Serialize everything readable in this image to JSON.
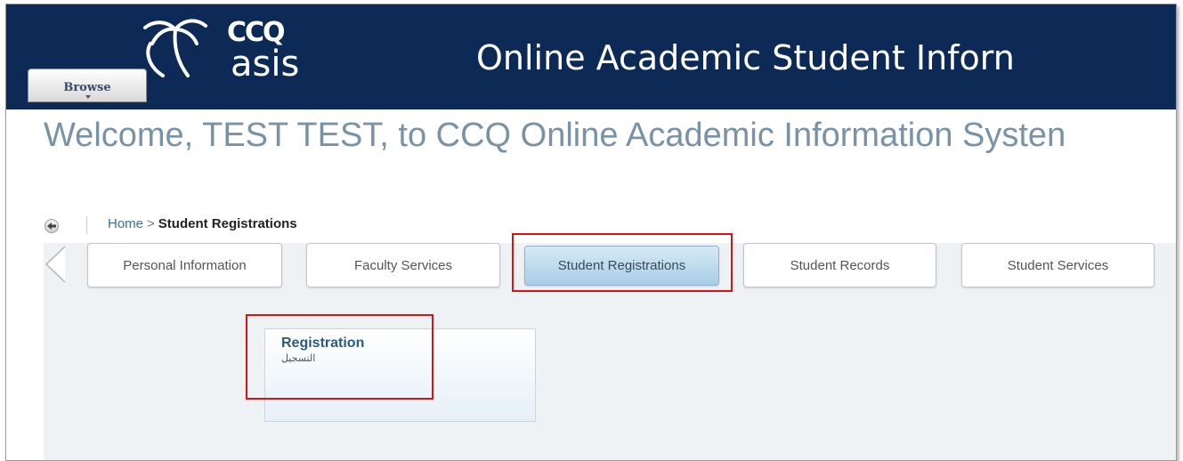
{
  "header": {
    "logo_ccq": "CCQ",
    "logo_asis": "asis",
    "title": "Online Academic Student Inforn",
    "browse_label": "Browse"
  },
  "welcome": "Welcome, TEST TEST, to CCQ Online Academic Information Systen",
  "breadcrumb": {
    "home": "Home",
    "separator": ">",
    "current": "Student Registrations"
  },
  "tabs": [
    {
      "label": "Personal Information",
      "active": false
    },
    {
      "label": "Faculty Services",
      "active": false
    },
    {
      "label": "Student Registrations",
      "active": true
    },
    {
      "label": "Student Records",
      "active": false
    },
    {
      "label": "Student Services",
      "active": false
    }
  ],
  "card": {
    "title": "Registration",
    "subtitle": "التسجيل"
  },
  "colors": {
    "header_bg": "#0d2a57",
    "highlight": "#e01010",
    "active_tab": "#a9cde6",
    "welcome_text": "#7892a6"
  },
  "icons": {
    "logo": "palm-tree-icon",
    "back": "back-arrow-icon",
    "prev": "chevron-left-icon",
    "browse": "caret-down-icon"
  }
}
